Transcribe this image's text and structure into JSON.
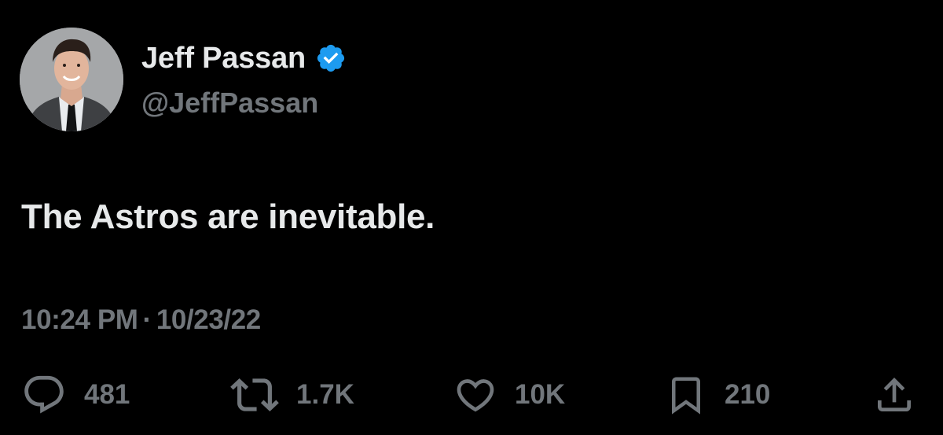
{
  "author": {
    "display_name": "Jeff Passan",
    "handle": "@JeffPassan",
    "verified": true,
    "verified_color": "#1d9bf0"
  },
  "tweet": {
    "text": "The Astros are inevitable.",
    "time": "10:24 PM",
    "separator": "·",
    "date": "10/23/22"
  },
  "actions": {
    "reply": {
      "icon": "reply-icon",
      "count": "481"
    },
    "retweet": {
      "icon": "retweet-icon",
      "count": "1.7K"
    },
    "like": {
      "icon": "heart-icon",
      "count": "10K"
    },
    "bookmark": {
      "icon": "bookmark-icon",
      "count": "210"
    },
    "share": {
      "icon": "share-icon"
    }
  },
  "colors": {
    "background": "#000000",
    "primary_text": "#e7e9ea",
    "secondary_text": "#71767b"
  }
}
